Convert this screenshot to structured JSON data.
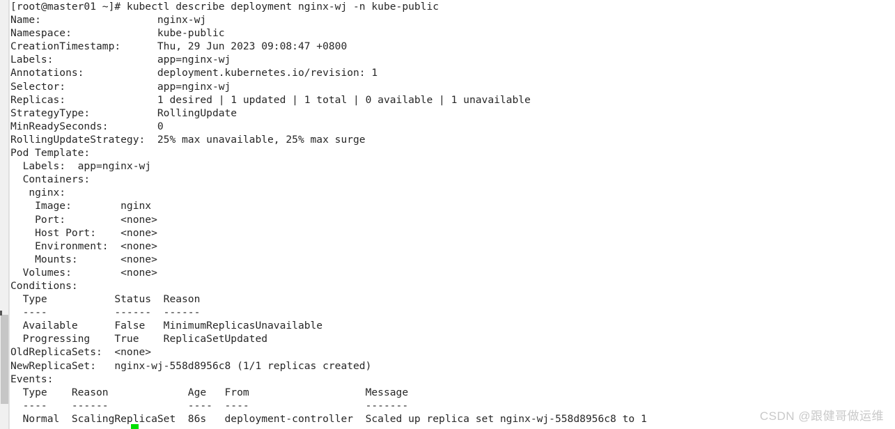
{
  "window": {
    "title": "kubectl describe deployment nginx-wj -n kube-public"
  },
  "scrollbar": {
    "name": "vertical-scrollbar",
    "thumb_label": "scroll-thumb"
  },
  "watermark": {
    "text": "CSDN @跟健哥做运维"
  },
  "cursor": {
    "color": "#00e000",
    "state": "block"
  },
  "colors": {
    "background": "#ffffff",
    "foreground": "#262626",
    "cursor": "#00e000",
    "scrollbar_track": "#f0f0f0",
    "scrollbar_thumb": "#c6c6c6",
    "watermark": "#c9c9c9"
  },
  "terminal": {
    "prompt": "[root@master01 ~]# ",
    "command": "kubectl describe deployment nginx-wj -n kube-public",
    "lines": [
      "[root@master01 ~]# kubectl describe deployment nginx-wj -n kube-public",
      "Name:                   nginx-wj",
      "Namespace:              kube-public",
      "CreationTimestamp:      Thu, 29 Jun 2023 09:08:47 +0800",
      "Labels:                 app=nginx-wj",
      "Annotations:            deployment.kubernetes.io/revision: 1",
      "Selector:               app=nginx-wj",
      "Replicas:               1 desired | 1 updated | 1 total | 0 available | 1 unavailable",
      "StrategyType:           RollingUpdate",
      "MinReadySeconds:        0",
      "RollingUpdateStrategy:  25% max unavailable, 25% max surge",
      "Pod Template:",
      "  Labels:  app=nginx-wj",
      "  Containers:",
      "   nginx:",
      "    Image:        nginx",
      "    Port:         <none>",
      "    Host Port:    <none>",
      "    Environment:  <none>",
      "    Mounts:       <none>",
      "  Volumes:        <none>",
      "Conditions:",
      "  Type           Status  Reason",
      "  ----           ------  ------",
      "  Available      False   MinimumReplicasUnavailable",
      "  Progressing    True    ReplicaSetUpdated",
      "OldReplicaSets:  <none>",
      "NewReplicaSet:   nginx-wj-558d8956c8 (1/1 replicas created)",
      "Events:",
      "  Type    Reason             Age   From                   Message",
      "  ----    ------             ----  ----                   -------",
      "  Normal  ScalingReplicaSet  86s   deployment-controller  Scaled up replica set nginx-wj-558d8956c8 to 1"
    ],
    "describe": {
      "Name": "nginx-wj",
      "Namespace": "kube-public",
      "CreationTimestamp": "Thu, 29 Jun 2023 09:08:47 +0800",
      "Labels": "app=nginx-wj",
      "Annotations": "deployment.kubernetes.io/revision: 1",
      "Selector": "app=nginx-wj",
      "Replicas": "1 desired | 1 updated | 1 total | 0 available | 1 unavailable",
      "StrategyType": "RollingUpdate",
      "MinReadySeconds": "0",
      "RollingUpdateStrategy": "25% max unavailable, 25% max surge",
      "OldReplicaSets": "<none>",
      "NewReplicaSet": "nginx-wj-558d8956c8 (1/1 replicas created)"
    },
    "pod_template": {
      "labels": "app=nginx-wj",
      "container_name": "nginx",
      "image": "nginx",
      "port": "<none>",
      "host_port": "<none>",
      "environment": "<none>",
      "mounts": "<none>",
      "volumes": "<none>"
    },
    "conditions": {
      "headers": [
        "Type",
        "Status",
        "Reason"
      ],
      "rows": [
        [
          "Available",
          "False",
          "MinimumReplicasUnavailable"
        ],
        [
          "Progressing",
          "True",
          "ReplicaSetUpdated"
        ]
      ]
    },
    "events": {
      "headers": [
        "Type",
        "Reason",
        "Age",
        "From",
        "Message"
      ],
      "rows": [
        [
          "Normal",
          "ScalingReplicaSet",
          "86s",
          "deployment-controller",
          "Scaled up replica set nginx-wj-558d8956c8 to 1"
        ]
      ]
    }
  }
}
